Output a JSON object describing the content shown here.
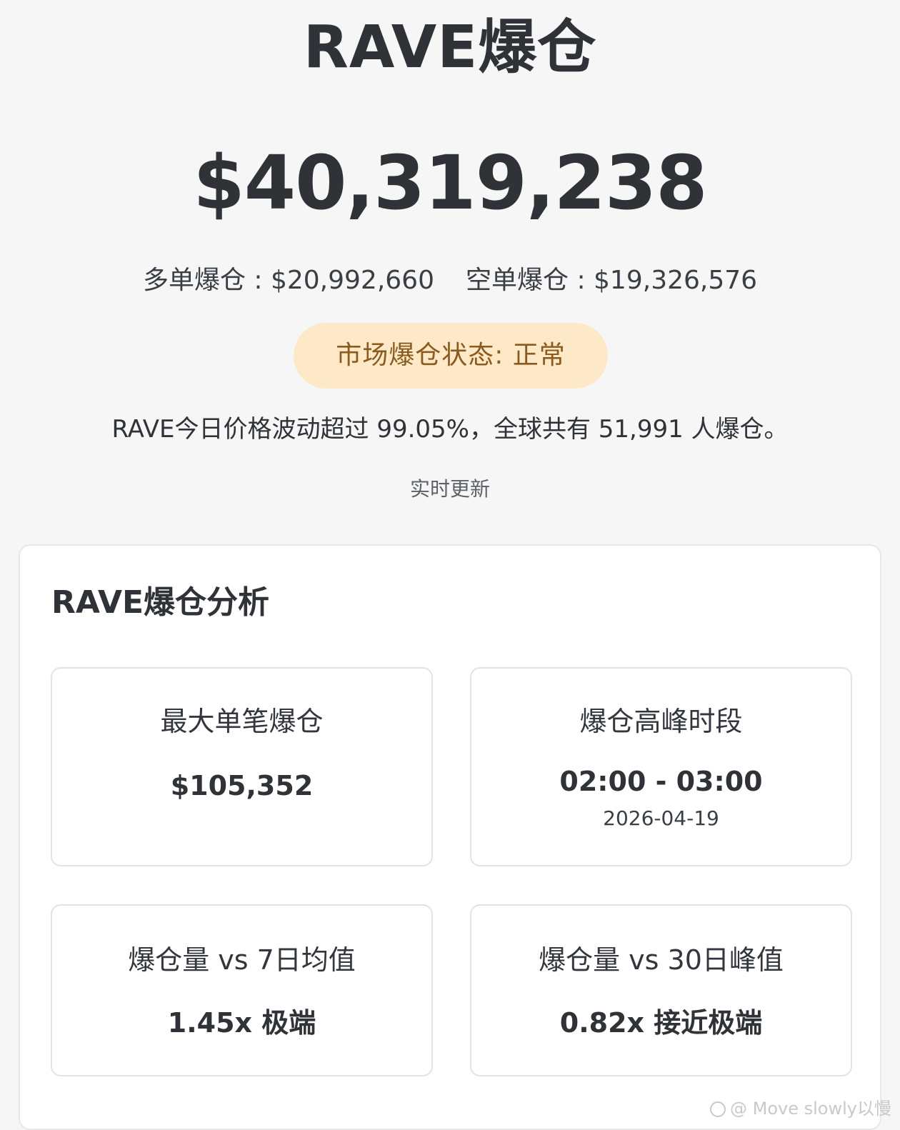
{
  "header": {
    "title": "RAVE爆仓",
    "total_amount": "$40,319,238"
  },
  "split": {
    "long_label": "多单爆仓 : ",
    "long_value": "$20,992,660",
    "short_label": "空单爆仓 : ",
    "short_value": "$19,326,576"
  },
  "status": {
    "text": "市场爆仓状态: 正常",
    "bg_color": "#fde9c8",
    "text_color": "#8a5a1e"
  },
  "summary": {
    "text": "RAVE今日价格波动超过 99.05%，全球共有 51,991 人爆仓。"
  },
  "realtime": {
    "label": "实时更新"
  },
  "analysis": {
    "title": "RAVE爆仓分析",
    "metrics": [
      {
        "label": "最大单笔爆仓",
        "value": "$105,352"
      },
      {
        "label": "爆仓高峰时段",
        "value": "02:00 - 03:00",
        "sub": "2026-04-19"
      },
      {
        "label": "爆仓量 vs 7日均值",
        "value": "1.45x 极端"
      },
      {
        "label": "爆仓量 vs 30日峰值",
        "value": "0.82x 接近极端"
      }
    ]
  },
  "watermark": {
    "text": "@ Move slowly以慢"
  }
}
